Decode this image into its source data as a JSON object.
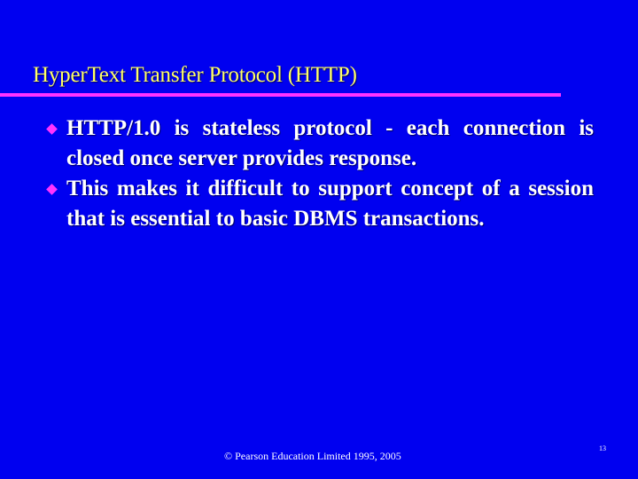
{
  "slide": {
    "title": "HyperText Transfer Protocol (HTTP)",
    "bullets": [
      {
        "text": "HTTP/1.0 is stateless protocol - each connection is closed once server provides response."
      },
      {
        "text": "This makes it difficult to support concept of a session that is essential to basic DBMS transactions."
      }
    ],
    "footer": "© Pearson Education Limited 1995, 2005",
    "page_number": "13"
  },
  "colors": {
    "background": "#0000f0",
    "title": "#ffff66",
    "accent": "#ff33ff",
    "body_text": "#ffffff"
  }
}
